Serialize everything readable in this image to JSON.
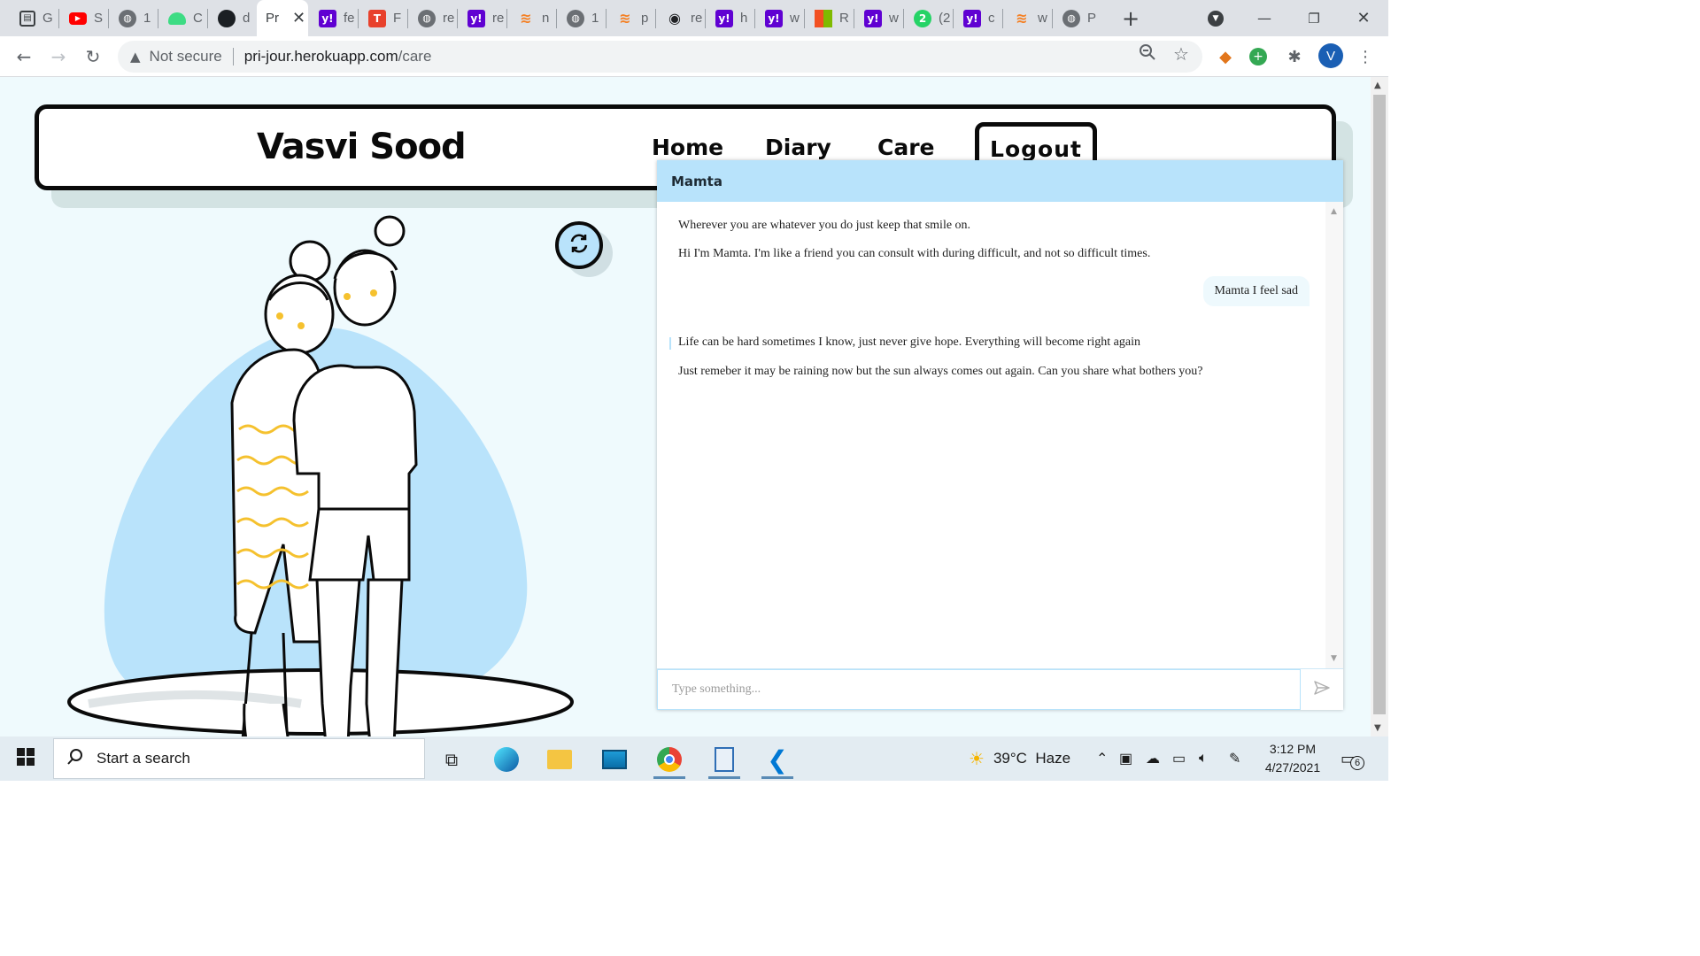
{
  "browser": {
    "tabs": [
      {
        "label": "G",
        "icon": "sheet-icon",
        "color": "#3c4043"
      },
      {
        "label": "S",
        "icon": "youtube-icon",
        "color": "#ff0000"
      },
      {
        "label": "1",
        "icon": "globe-icon",
        "color": "#5f6368"
      },
      {
        "label": "C",
        "icon": "android-icon",
        "color": "#3ddc84"
      },
      {
        "label": "d",
        "icon": "github-icon",
        "color": "#1b1f23"
      },
      {
        "label": "Pr",
        "icon": "",
        "color": "#5f6368",
        "active": true
      },
      {
        "label": "fe",
        "icon": "yahoo-icon",
        "color": "#6001d2"
      },
      {
        "label": "F",
        "icon": "t-icon",
        "color": "#e8412c"
      },
      {
        "label": "re",
        "icon": "globe-icon",
        "color": "#5f6368"
      },
      {
        "label": "re",
        "icon": "yahoo-icon",
        "color": "#6001d2"
      },
      {
        "label": "n",
        "icon": "stack-icon",
        "color": "#f48024"
      },
      {
        "label": "1",
        "icon": "globe-icon",
        "color": "#5f6368"
      },
      {
        "label": "p",
        "icon": "stack-icon",
        "color": "#f48024"
      },
      {
        "label": "re",
        "icon": "eye-icon",
        "color": "#202124"
      },
      {
        "label": "h",
        "icon": "yahoo-icon",
        "color": "#6001d2"
      },
      {
        "label": "w",
        "icon": "yahoo-icon",
        "color": "#6001d2"
      },
      {
        "label": "R",
        "icon": "microsoft-icon",
        "color": "#f25022"
      },
      {
        "label": "w",
        "icon": "yahoo-icon",
        "color": "#6001d2"
      },
      {
        "label": "(2",
        "icon": "whatsapp-icon",
        "color": "#25d366"
      },
      {
        "label": "c",
        "icon": "yahoo-icon",
        "color": "#6001d2"
      },
      {
        "label": "w",
        "icon": "stack-icon",
        "color": "#f48024"
      },
      {
        "label": "P",
        "icon": "globe-icon",
        "color": "#5f6368"
      }
    ],
    "address": {
      "security_label": "Not secure",
      "host": "pri-jour.herokuapp.com",
      "path": "/care"
    },
    "profile_initial": "V"
  },
  "site": {
    "title": "Vasvi Sood",
    "nav": {
      "home": "Home",
      "diary": "Diary",
      "care": "Care",
      "logout": "Logout"
    }
  },
  "chat": {
    "title": "Mamta",
    "messages": [
      {
        "from": "bot",
        "text": "Wherever you are whatever you do just keep that smile on."
      },
      {
        "from": "bot",
        "text": "Hi I'm Mamta. I'm like a friend you can consult with during difficult, and not so difficult times."
      },
      {
        "from": "user",
        "text": "Mamta I feel sad"
      },
      {
        "from": "bot",
        "text": "Life can be hard sometimes I know, just never give hope. Everything will become right again"
      },
      {
        "from": "bot",
        "text": "Just remeber it may be raining now but the sun always comes out again. Can you share what bothers you?"
      }
    ],
    "input_placeholder": "Type something..."
  },
  "taskbar": {
    "search_placeholder": "Start a search",
    "weather": "39°C  Haze",
    "time": "3:12 PM",
    "date": "4/27/2021",
    "notifications": "6"
  },
  "colors": {
    "page_bg": "#effafd",
    "accent": "#b8e3fb",
    "ink": "#0a0a0a"
  }
}
